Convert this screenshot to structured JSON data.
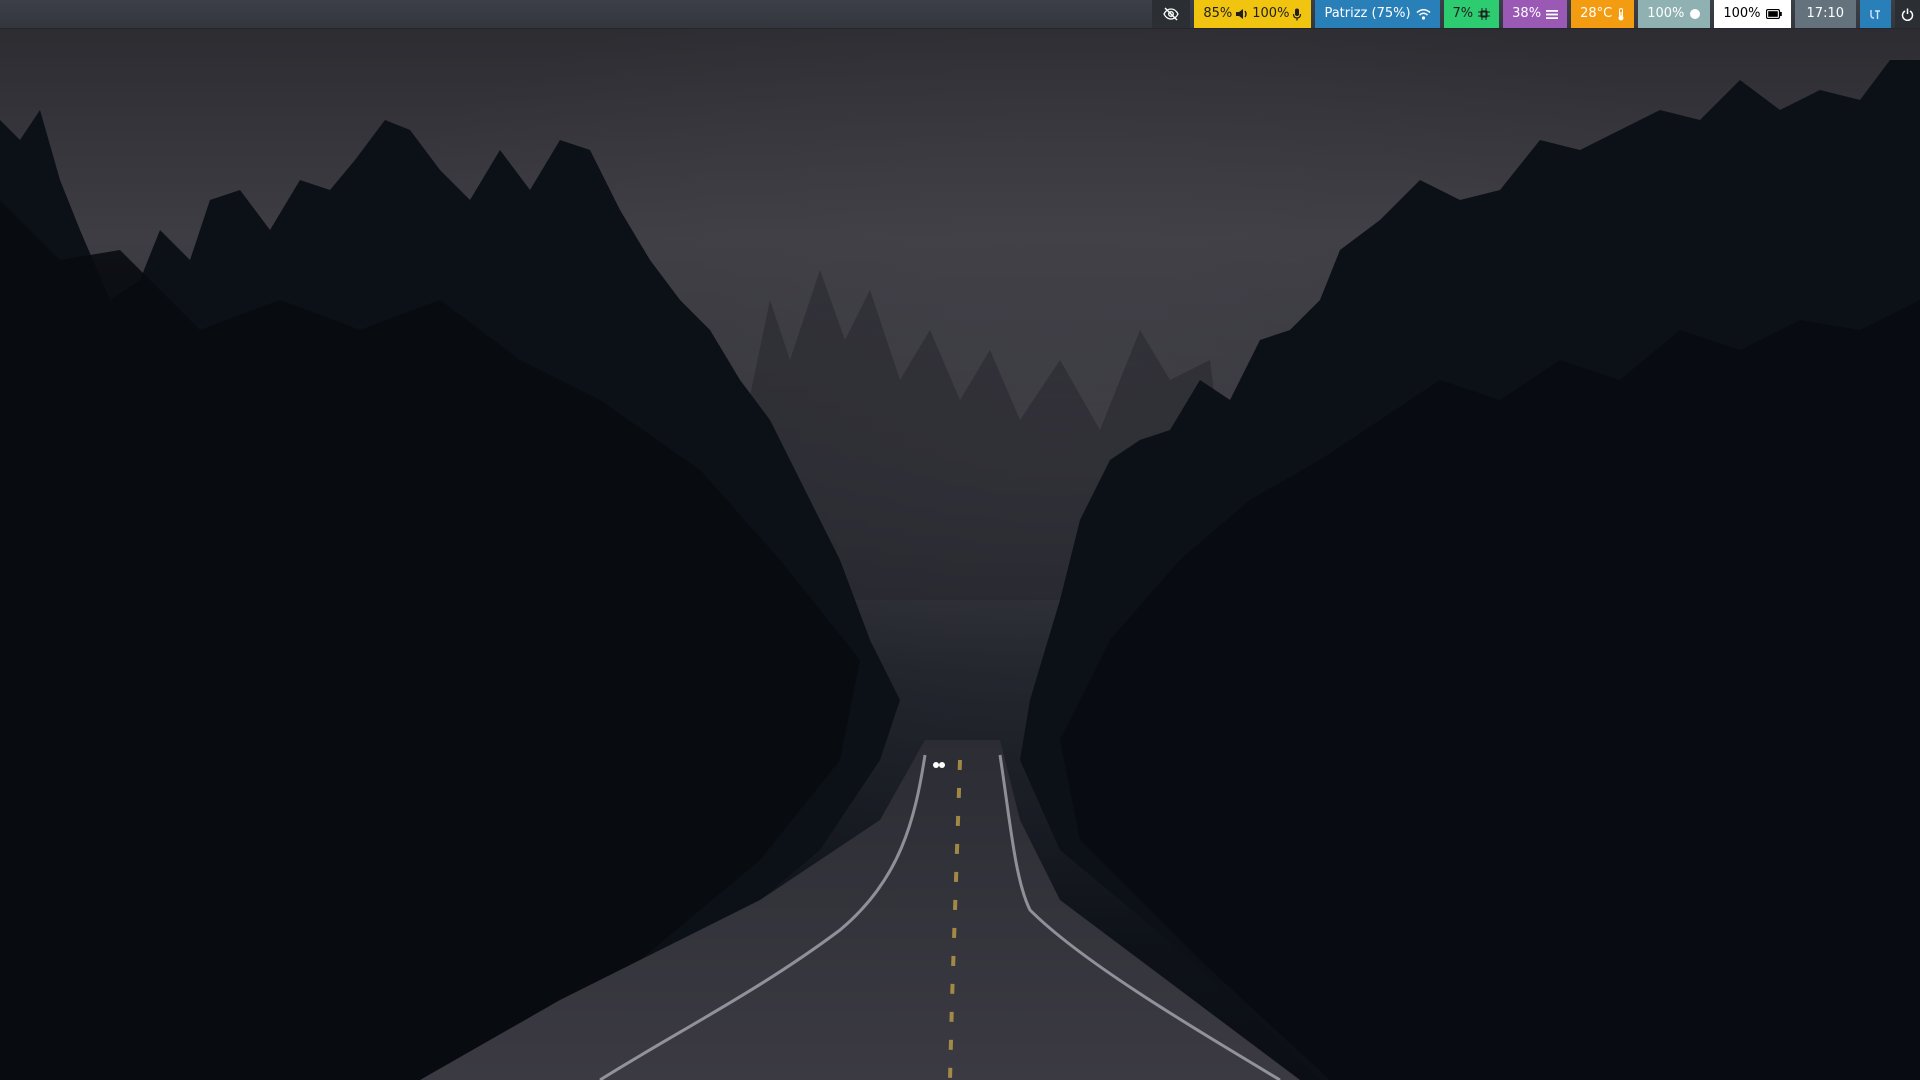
{
  "colors": {
    "bar_bg": "#383b42",
    "audio": "#f1c40f",
    "network": "#2980b9",
    "cpu": "#2ecc71",
    "memory": "#9b59b6",
    "temperature": "#f39c12",
    "backlight": "#90b1b1",
    "battery": "#ffffff",
    "clock": "#64727d",
    "tray": "#2980b9"
  },
  "statusbar": {
    "idle_inhibitor": {
      "icon": "eye-slash-icon"
    },
    "audio": {
      "volume": "85%",
      "volume_icon": "speaker-icon",
      "mic": "100%",
      "mic_icon": "microphone-icon"
    },
    "network": {
      "ssid_strength": "Patrizz (75%)",
      "icon": "wifi-icon"
    },
    "cpu": {
      "value": "7%",
      "icon": "cpu-chip-icon"
    },
    "memory": {
      "value": "38%",
      "icon": "memory-bars-icon"
    },
    "temperature": {
      "value": "28°C",
      "icon": "thermometer-icon"
    },
    "backlight": {
      "value": "100%",
      "icon": "brightness-circle-icon"
    },
    "battery": {
      "value": "100%",
      "icon": "battery-full-icon"
    },
    "clock": {
      "time": "17:10"
    },
    "tray": {
      "icon": "tray-app-icon"
    },
    "power": {
      "icon": "power-icon"
    }
  },
  "wallpaper": {
    "description_visible": false
  }
}
